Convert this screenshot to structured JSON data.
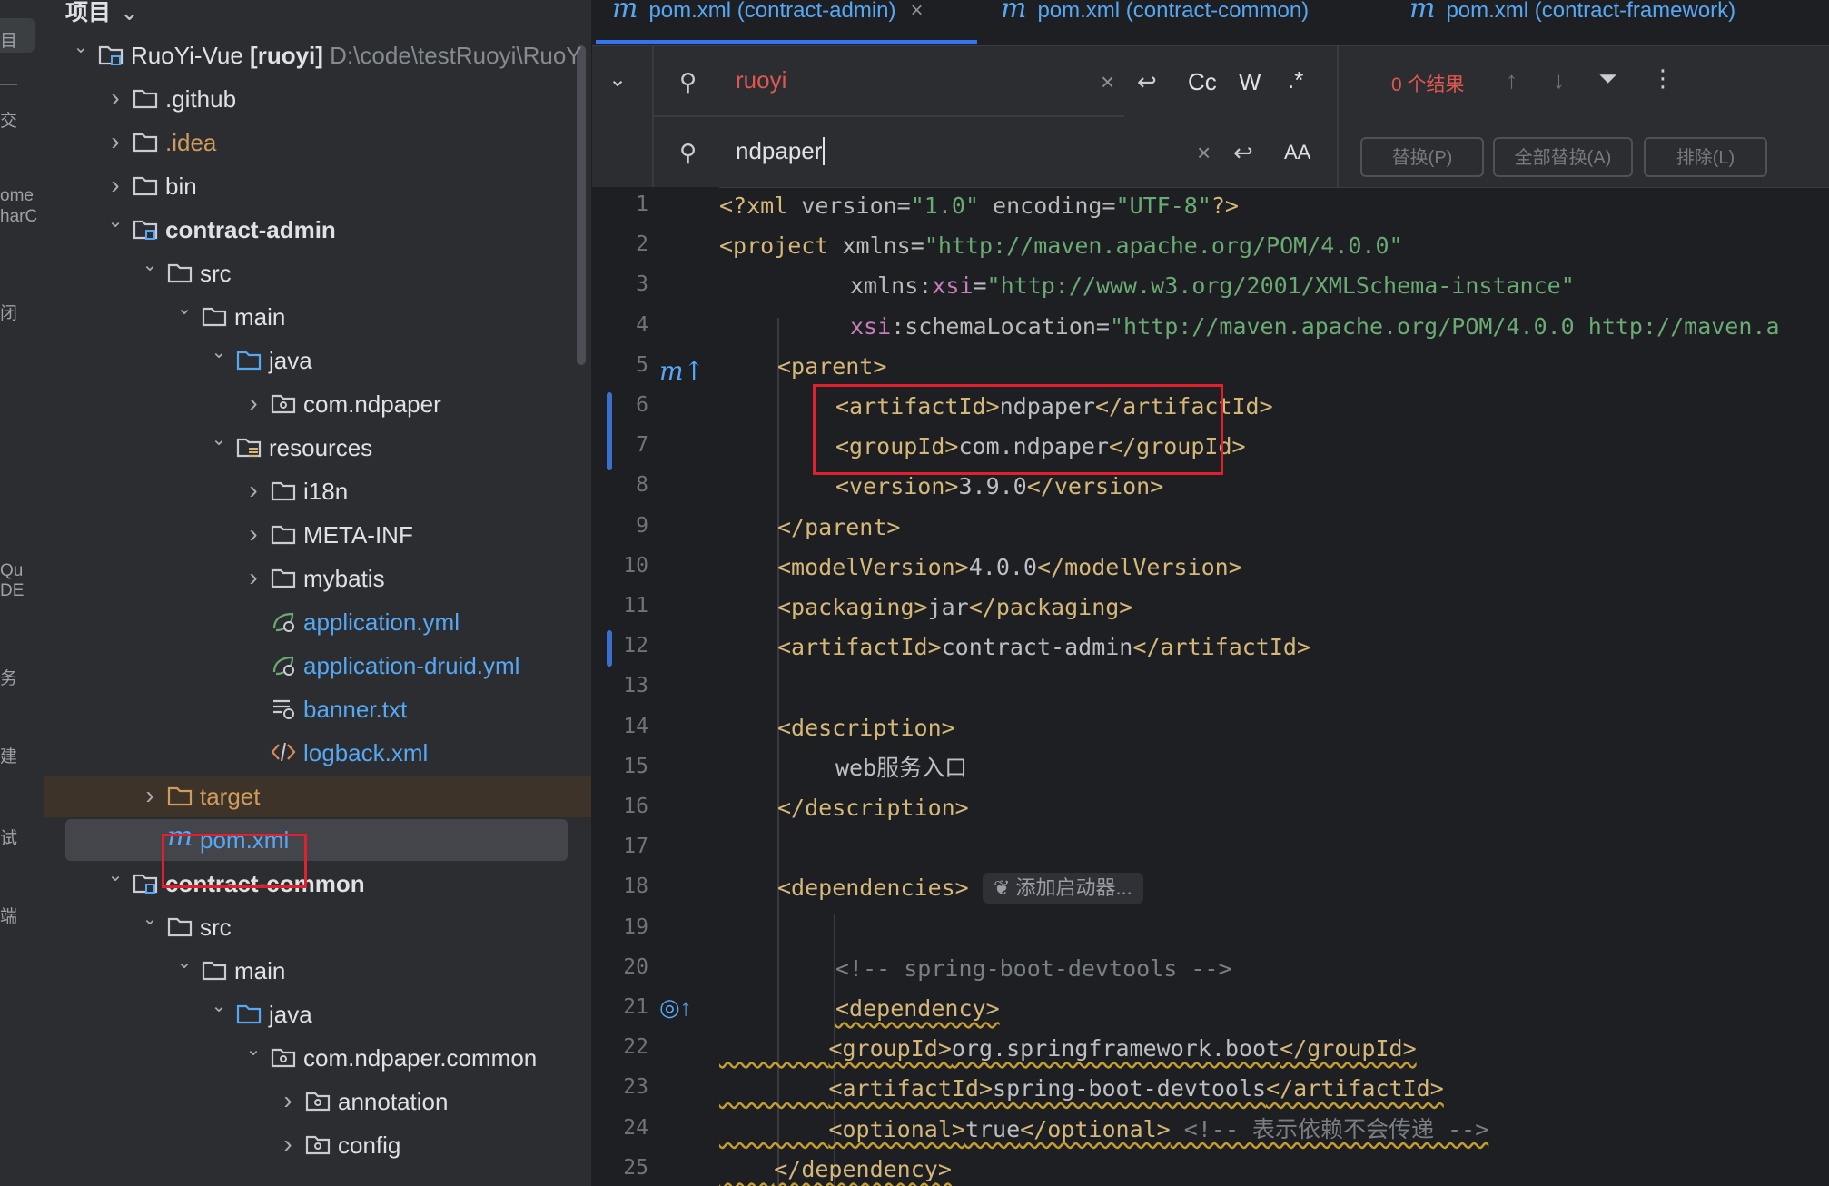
{
  "activity_bar": {
    "fragments": [
      "目",
      "—",
      "交",
      "ome",
      "harC",
      "闭",
      "Qu",
      "DE",
      "务",
      "建",
      "试",
      "端"
    ]
  },
  "project_panel": {
    "title": "项目",
    "tree": [
      {
        "label": "RuoYi-Vue",
        "suffix": "[ruoyi]",
        "path": "D:\\code\\testRuoyi\\RuoY",
        "icon": "module-icon"
      },
      {
        "label": ".github",
        "icon": "folder-icon"
      },
      {
        "label": ".idea",
        "icon": "folder-icon"
      },
      {
        "label": "bin",
        "icon": "folder-icon"
      },
      {
        "label": "contract-admin",
        "icon": "module-icon"
      },
      {
        "label": "src",
        "icon": "folder-icon"
      },
      {
        "label": "main",
        "icon": "folder-icon"
      },
      {
        "label": "java",
        "icon": "source-folder-icon"
      },
      {
        "label": "com.ndpaper",
        "icon": "package-icon"
      },
      {
        "label": "resources",
        "icon": "resources-folder-icon"
      },
      {
        "label": "i18n",
        "icon": "folder-icon"
      },
      {
        "label": "META-INF",
        "icon": "folder-icon"
      },
      {
        "label": "mybatis",
        "icon": "folder-icon"
      },
      {
        "label": "application.yml",
        "icon": "spring-config-icon"
      },
      {
        "label": "application-druid.yml",
        "icon": "spring-config-icon"
      },
      {
        "label": "banner.txt",
        "icon": "text-file-icon"
      },
      {
        "label": "logback.xml",
        "icon": "xml-file-icon"
      },
      {
        "label": "target",
        "icon": "excluded-folder-icon"
      },
      {
        "label": "pom.xml",
        "icon": "maven-icon"
      },
      {
        "label": "contract-common",
        "icon": "module-icon"
      },
      {
        "label": "src",
        "icon": "folder-icon"
      },
      {
        "label": "main",
        "icon": "folder-icon"
      },
      {
        "label": "java",
        "icon": "source-folder-icon"
      },
      {
        "label": "com.ndpaper.common",
        "icon": "package-icon"
      },
      {
        "label": "annotation",
        "icon": "package-icon"
      },
      {
        "label": "config",
        "icon": "package-icon"
      }
    ]
  },
  "editor": {
    "tabs": [
      {
        "label": "pom.xml (contract-admin)",
        "active": true
      },
      {
        "label": "pom.xml (contract-common)",
        "active": false
      },
      {
        "label": "pom.xml (contract-framework)",
        "active": false
      }
    ],
    "find": {
      "search_value": "ruoyi",
      "replace_value": "ndpaper",
      "match_case_label": "Cc",
      "words_label": "W",
      "regex_label": ".*",
      "preserve_case_label": "AA",
      "result_text": "0 个结果",
      "replace_button": "替换(P)",
      "replace_all_button": "全部替换(A)",
      "exclude_button": "排除(L)"
    },
    "line_numbers": [
      "1",
      "2",
      "3",
      "4",
      "5",
      "6",
      "7",
      "8",
      "9",
      "10",
      "11",
      "12",
      "13",
      "14",
      "15",
      "16",
      "17",
      "18",
      "19",
      "20",
      "21",
      "22",
      "23",
      "24",
      "25"
    ],
    "code": {
      "l1": [
        "<?xml",
        " version=",
        "\"1.0\"",
        " encoding=",
        "\"UTF-8\"",
        "?>"
      ],
      "l2": [
        "<project",
        " xmlns=",
        "\"http://maven.apache.org/POM/4.0.0\""
      ],
      "l3": [
        "xmlns",
        ":",
        "xsi",
        "=",
        "\"http://www.w3.org/2001/XMLSchema-instance\""
      ],
      "l4": [
        "xsi",
        ":schemaLocation=",
        "\"http://maven.apache.org/POM/4.0.0 http://maven.a"
      ],
      "l5": "<parent>",
      "l6": [
        "<artifactId>",
        "ndpaper",
        "</artifactId>"
      ],
      "l7": [
        "<groupId>",
        "com.ndpaper",
        "</groupId>"
      ],
      "l8": [
        "<version>",
        "3.9.0",
        "</version>"
      ],
      "l9": "</parent>",
      "l10": [
        "<modelVersion>",
        "4.0.0",
        "</modelVersion>"
      ],
      "l11": [
        "<packaging>",
        "jar",
        "</packaging>"
      ],
      "l12": [
        "<artifactId>",
        "contract-admin",
        "</artifactId>"
      ],
      "l14": "<description>",
      "l15": "web服务入口",
      "l16": "</description>",
      "l18": "<dependencies>",
      "l18_hint": "添加启动器...",
      "l20": "<!-- spring-boot-devtools -->",
      "l21": "<dependency>",
      "l22": [
        "<groupId>",
        "org.springframework.boot",
        "</groupId>"
      ],
      "l23": [
        "<artifactId>",
        "spring-boot-devtools",
        "</artifactId>"
      ],
      "l24": [
        "<optional>",
        "true",
        "</optional>",
        " <!-- 表示依赖不会传递 -->"
      ],
      "l25": "</dependency>"
    }
  },
  "colors": {
    "accent": "#3574f0",
    "highlight_box": "#e0202c",
    "tag": "#d5b778",
    "string": "#6aab73",
    "link_blue": "#56a8f5"
  }
}
